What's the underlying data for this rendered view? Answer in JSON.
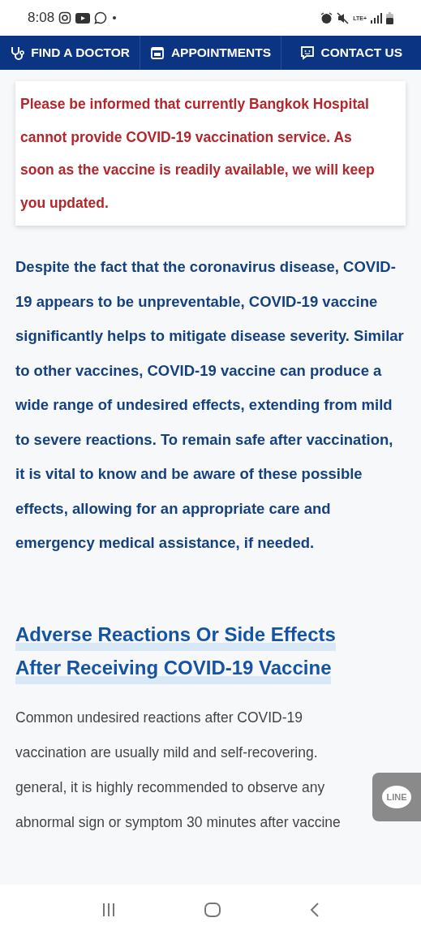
{
  "status_bar": {
    "time": "8:08",
    "network": "LTE+"
  },
  "nav": [
    {
      "label": "FIND A DOCTOR"
    },
    {
      "label": "APPOINTMENTS"
    },
    {
      "label": "CONTACT US"
    }
  ],
  "notice": "Please be informed that currently Bangkok Hospital cannot provide COVID-19 vaccination service. As soon as the vaccine is readily available, we will keep you updated.",
  "intro": "Despite the fact that the coronavirus disease, COVID-19 appears to be unpreventable, COVID-19 vaccine significantly helps to mitigate disease severity. Similar to other vaccines, COVID-19 vaccine can produce a wide range of undesired effects, extending from mild to severe reactions. To remain safe after vaccination, it is vital to know and be aware of these possible effects, allowing for an appropriate care and emergency medical assistance, if needed.",
  "heading_lines": [
    "Adverse Reactions Or Side Effects",
    "After Receiving COVID-19 Vaccine"
  ],
  "body_lines": [
    "Common undesired reactions after COVID-19",
    "vaccination are usually mild and self-recovering.",
    "general, it is highly recommended to observe any",
    "abnormal sign or symptom 30 minutes after vaccine"
  ],
  "chat_button": {
    "label": "LINE"
  }
}
